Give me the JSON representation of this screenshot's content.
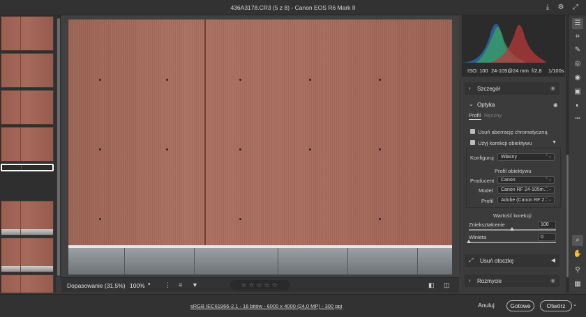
{
  "window": {
    "title": "436A3178.CR3 (5 z 8)  -  Canon EOS R6 Mark II"
  },
  "viewer": {
    "zoom_label": "Dopasowanie (31,5%)",
    "zoom_percent": "100%"
  },
  "rating": {
    "stars": "☆☆☆☆☆",
    "stars_value": 0
  },
  "exif": {
    "iso": "ISO: 100",
    "lens": "24-105@24 mm",
    "aperture": "f/2,8",
    "shutter": "1/100s"
  },
  "panel": {
    "detail": "Szczegół",
    "optics": "Optyka",
    "tab_profile": "Profil",
    "tab_manual": "Ręczny",
    "remove_ca": "Usuń aberrację chromatyczną",
    "use_lens_correction": "Użyj korekcji obiektywu",
    "configure_label": "Konfiguruj",
    "configure_value": "Własny",
    "lens_profile_heading": "Profil obiektywu",
    "maker_label": "Producent",
    "maker_value": "Canon",
    "model_label": "Model",
    "model_value": "Canon RF 24-105m...",
    "profile_label": "Profil",
    "profile_value": "Adobe (Canon RF 2...",
    "correction_heading": "Wartość korekcji",
    "distortion_label": "Zniekształcenie",
    "distortion_value": "100",
    "vignette_label": "Winieta",
    "vignette_value": "0",
    "remove_fringe": "Usuń otoczkę",
    "transform": "Rozmycie"
  },
  "footer": {
    "info": "sRGB IEC61966-2.1 - 16 bitów - 6000 x 4000 (24,0 MP) - 300 ppi",
    "cancel": "Anuluj",
    "done": "Gotowe",
    "open": "Otwórz"
  },
  "icons": {
    "export": "⤓",
    "gear": "⚙",
    "expand": "⤢",
    "edit": "☰",
    "crop": "⌗",
    "erase": "✎",
    "mask": "◎",
    "redeye": "◉",
    "presets": "▣",
    "snapshots": "◐",
    "more": "•••",
    "zoom": "⌕",
    "hand": "✋",
    "eyedropper": "⚲",
    "grid": "▦"
  }
}
